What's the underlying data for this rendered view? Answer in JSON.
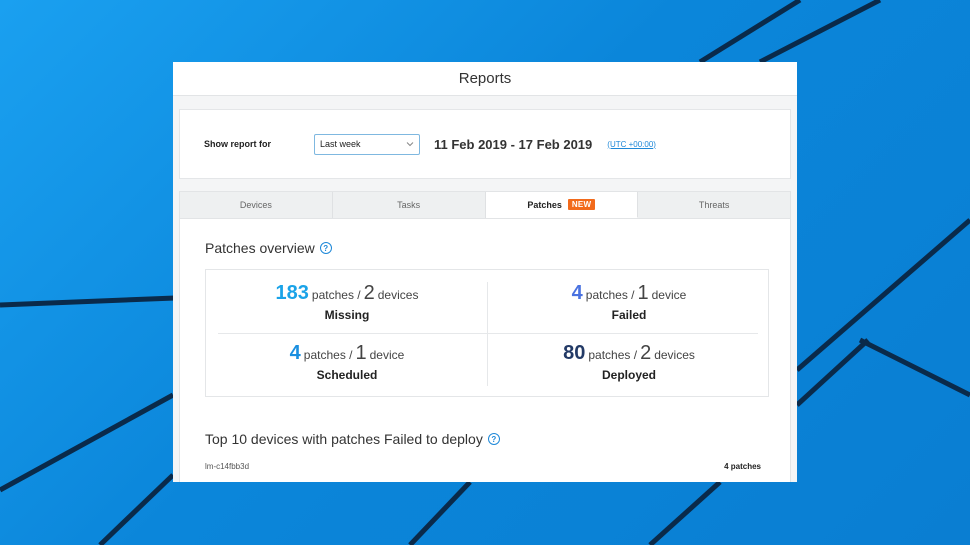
{
  "window": {
    "title": "Reports"
  },
  "report": {
    "label": "Show report for",
    "period": "Last week",
    "date_range": "11 Feb 2019 - 17 Feb 2019",
    "timezone": "(UTC +00:00)"
  },
  "tabs": [
    {
      "label": "Devices"
    },
    {
      "label": "Tasks"
    },
    {
      "label": "Patches",
      "badge": "NEW",
      "active": true
    },
    {
      "label": "Threats"
    }
  ],
  "overview": {
    "title": "Patches overview",
    "stats": {
      "missing": {
        "count": "183",
        "count_unit": "patches /",
        "devices": "2",
        "devices_unit": "devices",
        "label": "Missing",
        "color": "#1aa3e8"
      },
      "failed": {
        "count": "4",
        "count_unit": "patches /",
        "devices": "1",
        "devices_unit": "device",
        "label": "Failed",
        "color": "#4a72e0"
      },
      "scheduled": {
        "count": "4",
        "count_unit": "patches /",
        "devices": "1",
        "devices_unit": "device",
        "label": "Scheduled",
        "color": "#1a8fe0"
      },
      "deployed": {
        "count": "80",
        "count_unit": "patches /",
        "devices": "2",
        "devices_unit": "devices",
        "label": "Deployed",
        "color": "#233a66"
      }
    }
  },
  "top10": {
    "title": "Top 10 devices with patches Failed to deploy",
    "rows": [
      {
        "device": "lm-c14fbb3d",
        "count": "4 patches"
      }
    ]
  },
  "colors": {
    "accent": "#1e88d8",
    "badge": "#f26a1b"
  },
  "icons": {
    "help": "help-icon",
    "dropdown": "chevron-down-icon"
  }
}
